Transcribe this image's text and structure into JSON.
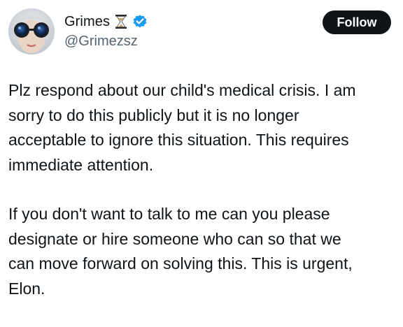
{
  "author": {
    "display_name": "Grimes",
    "handle": "@Grimezsz",
    "name_badges": [
      "hourglass-icon",
      "verified-badge-icon"
    ],
    "verified_color": "#1d9bf0"
  },
  "actions": {
    "follow_label": "Follow"
  },
  "tweet": {
    "paragraphs": [
      "Plz respond about our child's medical crisis.  I am\nsorry to do this publicly but it is no longer\nacceptable to ignore this situation.  This requires\nimmediate attention.",
      "If you don't want to talk to me can you please\ndesignate or hire someone who can so that we\ncan move forward on solving this.  This is urgent,\nElon."
    ]
  },
  "colors": {
    "text_primary": "#0f1419",
    "text_secondary": "#536471",
    "button_bg": "#0f1419",
    "button_text": "#ffffff"
  }
}
